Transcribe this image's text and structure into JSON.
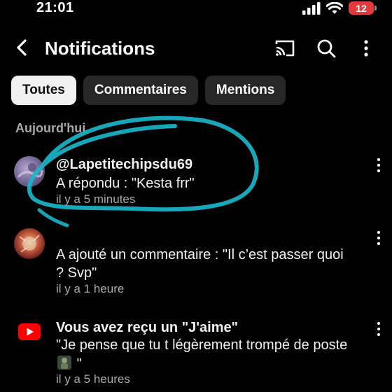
{
  "status_bar": {
    "time": "21:01",
    "battery": "12"
  },
  "header": {
    "title": "Notifications",
    "icons": [
      "back-icon",
      "cast-icon",
      "search-icon",
      "more-vertical-icon"
    ]
  },
  "tabs": [
    {
      "label": "Toutes",
      "selected": true
    },
    {
      "label": "Commentaires",
      "selected": false
    },
    {
      "label": "Mentions",
      "selected": false
    }
  ],
  "section_title": "Aujourd'hui",
  "notifications": [
    {
      "title": "@Lapetitechipsdu69",
      "body": "A répondu : \"Kesta frr\"",
      "time": "il y a 5 minutes"
    },
    {
      "title": "",
      "body": "A ajouté un commentaire : \"Il c’est passer quoi ? Svp\"",
      "time": "il y a 1 heure"
    },
    {
      "title": "Vous avez reçu un \"J'aime\"",
      "body": "\"Je pense que tu t légèrement trompé de poste",
      "body_end": "\"",
      "time": "il y a 5 heures"
    }
  ],
  "colors": {
    "background": "#000000",
    "chip_active_bg": "#f1f1f1",
    "chip_bg": "#272727",
    "secondary_text": "#aaaaaa",
    "battery_low": "#e23b3b",
    "youtube_red": "#ff0000",
    "highlight_scribble": "#19b5c8"
  }
}
